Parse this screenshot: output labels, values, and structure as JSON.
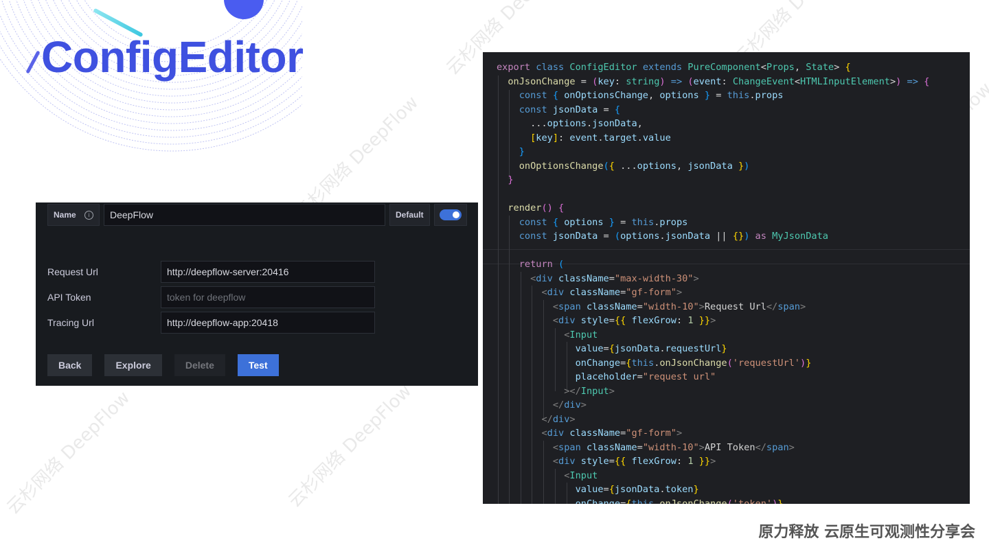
{
  "slide": {
    "title": "ConfigEditor",
    "footer": "原力释放 云原生可观测性分享会",
    "watermark": "云杉网络 DeepFlow",
    "accent_color": "#3f51e0"
  },
  "ui_panel": {
    "name_label": "Name",
    "info_icon": "info-icon",
    "name_value": "DeepFlow",
    "default_label": "Default",
    "default_toggle_on": true,
    "fields": [
      {
        "label": "Request Url",
        "value": "http://deepflow-server:20416",
        "placeholder": ""
      },
      {
        "label": "API Token",
        "value": "",
        "placeholder": "token for deepflow"
      },
      {
        "label": "Tracing Url",
        "value": "http://deepflow-app:20418",
        "placeholder": ""
      }
    ],
    "buttons": {
      "back": "Back",
      "explore": "Explore",
      "delete": "Delete",
      "test": "Test"
    },
    "colors": {
      "primary": "#3d71d9",
      "background": "#181b1f"
    }
  },
  "code": {
    "language": "tsx",
    "lines": [
      [
        [
          "k",
          "export "
        ],
        [
          "kb",
          "class "
        ],
        [
          "t",
          "ConfigEditor "
        ],
        [
          "kb",
          "extends "
        ],
        [
          "t",
          "PureComponent"
        ],
        [
          "x",
          "<"
        ],
        [
          "t",
          "Props"
        ],
        [
          "x",
          ", "
        ],
        [
          "t",
          "State"
        ],
        [
          "x",
          "> "
        ],
        [
          "p1",
          "{"
        ]
      ],
      [
        [
          "x",
          "  "
        ],
        [
          "f",
          "onJsonChange"
        ],
        [
          "x",
          " = "
        ],
        [
          "p2",
          "("
        ],
        [
          "v",
          "key"
        ],
        [
          "x",
          ": "
        ],
        [
          "t",
          "string"
        ],
        [
          "p2",
          ")"
        ],
        [
          "kb",
          " => "
        ],
        [
          "p2",
          "("
        ],
        [
          "v",
          "event"
        ],
        [
          "x",
          ": "
        ],
        [
          "t",
          "ChangeEvent"
        ],
        [
          "x",
          "<"
        ],
        [
          "t",
          "HTMLInputElement"
        ],
        [
          "x",
          ">"
        ],
        [
          "p2",
          ")"
        ],
        [
          "kb",
          " => "
        ],
        [
          "p2",
          "{"
        ]
      ],
      [
        [
          "x",
          "    "
        ],
        [
          "kb",
          "const "
        ],
        [
          "p3",
          "{ "
        ],
        [
          "v",
          "onOptionsChange"
        ],
        [
          "x",
          ", "
        ],
        [
          "v",
          "options "
        ],
        [
          "p3",
          "}"
        ],
        [
          "x",
          " = "
        ],
        [
          "kb",
          "this"
        ],
        [
          "x",
          "."
        ],
        [
          "v",
          "props"
        ]
      ],
      [
        [
          "x",
          "    "
        ],
        [
          "kb",
          "const "
        ],
        [
          "v",
          "jsonData"
        ],
        [
          "x",
          " = "
        ],
        [
          "p3",
          "{"
        ]
      ],
      [
        [
          "x",
          "      ..."
        ],
        [
          "v",
          "options"
        ],
        [
          "x",
          "."
        ],
        [
          "v",
          "jsonData"
        ],
        [
          "x",
          ","
        ]
      ],
      [
        [
          "x",
          "      "
        ],
        [
          "p1",
          "["
        ],
        [
          "v",
          "key"
        ],
        [
          "p1",
          "]"
        ],
        [
          "x",
          ": "
        ],
        [
          "v",
          "event"
        ],
        [
          "x",
          "."
        ],
        [
          "v",
          "target"
        ],
        [
          "x",
          "."
        ],
        [
          "v",
          "value"
        ]
      ],
      [
        [
          "x",
          "    "
        ],
        [
          "p3",
          "}"
        ]
      ],
      [
        [
          "x",
          "    "
        ],
        [
          "f",
          "onOptionsChange"
        ],
        [
          "p3",
          "("
        ],
        [
          "p1",
          "{ "
        ],
        [
          "x",
          "..."
        ],
        [
          "v",
          "options"
        ],
        [
          "x",
          ", "
        ],
        [
          "v",
          "jsonData "
        ],
        [
          "p1",
          "}"
        ],
        [
          "p3",
          ")"
        ]
      ],
      [
        [
          "x",
          "  "
        ],
        [
          "p2",
          "}"
        ]
      ],
      [
        [
          "x",
          ""
        ]
      ],
      [
        [
          "x",
          "  "
        ],
        [
          "f",
          "render"
        ],
        [
          "p2",
          "()"
        ],
        [
          "x",
          " "
        ],
        [
          "p2",
          "{"
        ]
      ],
      [
        [
          "x",
          "    "
        ],
        [
          "kb",
          "const "
        ],
        [
          "p3",
          "{ "
        ],
        [
          "v",
          "options "
        ],
        [
          "p3",
          "}"
        ],
        [
          "x",
          " = "
        ],
        [
          "kb",
          "this"
        ],
        [
          "x",
          "."
        ],
        [
          "v",
          "props"
        ]
      ],
      [
        [
          "x",
          "    "
        ],
        [
          "kb",
          "const "
        ],
        [
          "v",
          "jsonData"
        ],
        [
          "x",
          " = "
        ],
        [
          "p3",
          "("
        ],
        [
          "v",
          "options"
        ],
        [
          "x",
          "."
        ],
        [
          "v",
          "jsonData"
        ],
        [
          "x",
          " || "
        ],
        [
          "p1",
          "{}"
        ],
        [
          "p3",
          ")"
        ],
        [
          "k",
          " as "
        ],
        [
          "t",
          "MyJsonData"
        ]
      ],
      [
        [
          "x",
          ""
        ]
      ],
      [
        [
          "x",
          "    "
        ],
        [
          "k",
          "return "
        ],
        [
          "p3",
          "("
        ]
      ],
      [
        [
          "x",
          "      "
        ],
        [
          "tg",
          "<"
        ],
        [
          "kb",
          "div "
        ],
        [
          "v",
          "className"
        ],
        [
          "x",
          "="
        ],
        [
          "s",
          "\"max-width-30\""
        ],
        [
          "tg",
          ">"
        ]
      ],
      [
        [
          "x",
          "        "
        ],
        [
          "tg",
          "<"
        ],
        [
          "kb",
          "div "
        ],
        [
          "v",
          "className"
        ],
        [
          "x",
          "="
        ],
        [
          "s",
          "\"gf-form\""
        ],
        [
          "tg",
          ">"
        ]
      ],
      [
        [
          "x",
          "          "
        ],
        [
          "tg",
          "<"
        ],
        [
          "kb",
          "span "
        ],
        [
          "v",
          "className"
        ],
        [
          "x",
          "="
        ],
        [
          "s",
          "\"width-10\""
        ],
        [
          "tg",
          ">"
        ],
        [
          "x",
          "Request Url"
        ],
        [
          "tg",
          "</"
        ],
        [
          "kb",
          "span"
        ],
        [
          "tg",
          ">"
        ]
      ],
      [
        [
          "x",
          "          "
        ],
        [
          "tg",
          "<"
        ],
        [
          "kb",
          "div "
        ],
        [
          "v",
          "style"
        ],
        [
          "x",
          "="
        ],
        [
          "p1",
          "{{ "
        ],
        [
          "v",
          "flexGrow"
        ],
        [
          "x",
          ": "
        ],
        [
          "n",
          "1"
        ],
        [
          "p1",
          " }}"
        ],
        [
          "tg",
          ">"
        ]
      ],
      [
        [
          "x",
          "            "
        ],
        [
          "tg",
          "<"
        ],
        [
          "t",
          "Input"
        ]
      ],
      [
        [
          "x",
          "              "
        ],
        [
          "v",
          "value"
        ],
        [
          "x",
          "="
        ],
        [
          "p1",
          "{"
        ],
        [
          "v",
          "jsonData"
        ],
        [
          "x",
          "."
        ],
        [
          "v",
          "requestUrl"
        ],
        [
          "p1",
          "}"
        ]
      ],
      [
        [
          "x",
          "              "
        ],
        [
          "v",
          "onChange"
        ],
        [
          "x",
          "="
        ],
        [
          "p1",
          "{"
        ],
        [
          "kb",
          "this"
        ],
        [
          "x",
          "."
        ],
        [
          "f",
          "onJsonChange"
        ],
        [
          "p2",
          "("
        ],
        [
          "s",
          "'requestUrl'"
        ],
        [
          "p2",
          ")"
        ],
        [
          "p1",
          "}"
        ]
      ],
      [
        [
          "x",
          "              "
        ],
        [
          "v",
          "placeholder"
        ],
        [
          "x",
          "="
        ],
        [
          "s",
          "\"request url\""
        ]
      ],
      [
        [
          "x",
          "            "
        ],
        [
          "tg",
          "></"
        ],
        [
          "t",
          "Input"
        ],
        [
          "tg",
          ">"
        ]
      ],
      [
        [
          "x",
          "          "
        ],
        [
          "tg",
          "</"
        ],
        [
          "kb",
          "div"
        ],
        [
          "tg",
          ">"
        ]
      ],
      [
        [
          "x",
          "        "
        ],
        [
          "tg",
          "</"
        ],
        [
          "kb",
          "div"
        ],
        [
          "tg",
          ">"
        ]
      ],
      [
        [
          "x",
          "        "
        ],
        [
          "tg",
          "<"
        ],
        [
          "kb",
          "div "
        ],
        [
          "v",
          "className"
        ],
        [
          "x",
          "="
        ],
        [
          "s",
          "\"gf-form\""
        ],
        [
          "tg",
          ">"
        ]
      ],
      [
        [
          "x",
          "          "
        ],
        [
          "tg",
          "<"
        ],
        [
          "kb",
          "span "
        ],
        [
          "v",
          "className"
        ],
        [
          "x",
          "="
        ],
        [
          "s",
          "\"width-10\""
        ],
        [
          "tg",
          ">"
        ],
        [
          "x",
          "API Token"
        ],
        [
          "tg",
          "</"
        ],
        [
          "kb",
          "span"
        ],
        [
          "tg",
          ">"
        ]
      ],
      [
        [
          "x",
          "          "
        ],
        [
          "tg",
          "<"
        ],
        [
          "kb",
          "div "
        ],
        [
          "v",
          "style"
        ],
        [
          "x",
          "="
        ],
        [
          "p1",
          "{{ "
        ],
        [
          "v",
          "flexGrow"
        ],
        [
          "x",
          ": "
        ],
        [
          "n",
          "1"
        ],
        [
          "p1",
          " }}"
        ],
        [
          "tg",
          ">"
        ]
      ],
      [
        [
          "x",
          "            "
        ],
        [
          "tg",
          "<"
        ],
        [
          "t",
          "Input"
        ]
      ],
      [
        [
          "x",
          "              "
        ],
        [
          "v",
          "value"
        ],
        [
          "x",
          "="
        ],
        [
          "p1",
          "{"
        ],
        [
          "v",
          "jsonData"
        ],
        [
          "x",
          "."
        ],
        [
          "v",
          "token"
        ],
        [
          "p1",
          "}"
        ]
      ],
      [
        [
          "x",
          "              "
        ],
        [
          "v",
          "onChange"
        ],
        [
          "x",
          "="
        ],
        [
          "p1",
          "{"
        ],
        [
          "kb",
          "this"
        ],
        [
          "x",
          "."
        ],
        [
          "f",
          "onJsonChange"
        ],
        [
          "p2",
          "("
        ],
        [
          "s",
          "'token'"
        ],
        [
          "p2",
          ")"
        ],
        [
          "p1",
          "}"
        ]
      ]
    ]
  }
}
